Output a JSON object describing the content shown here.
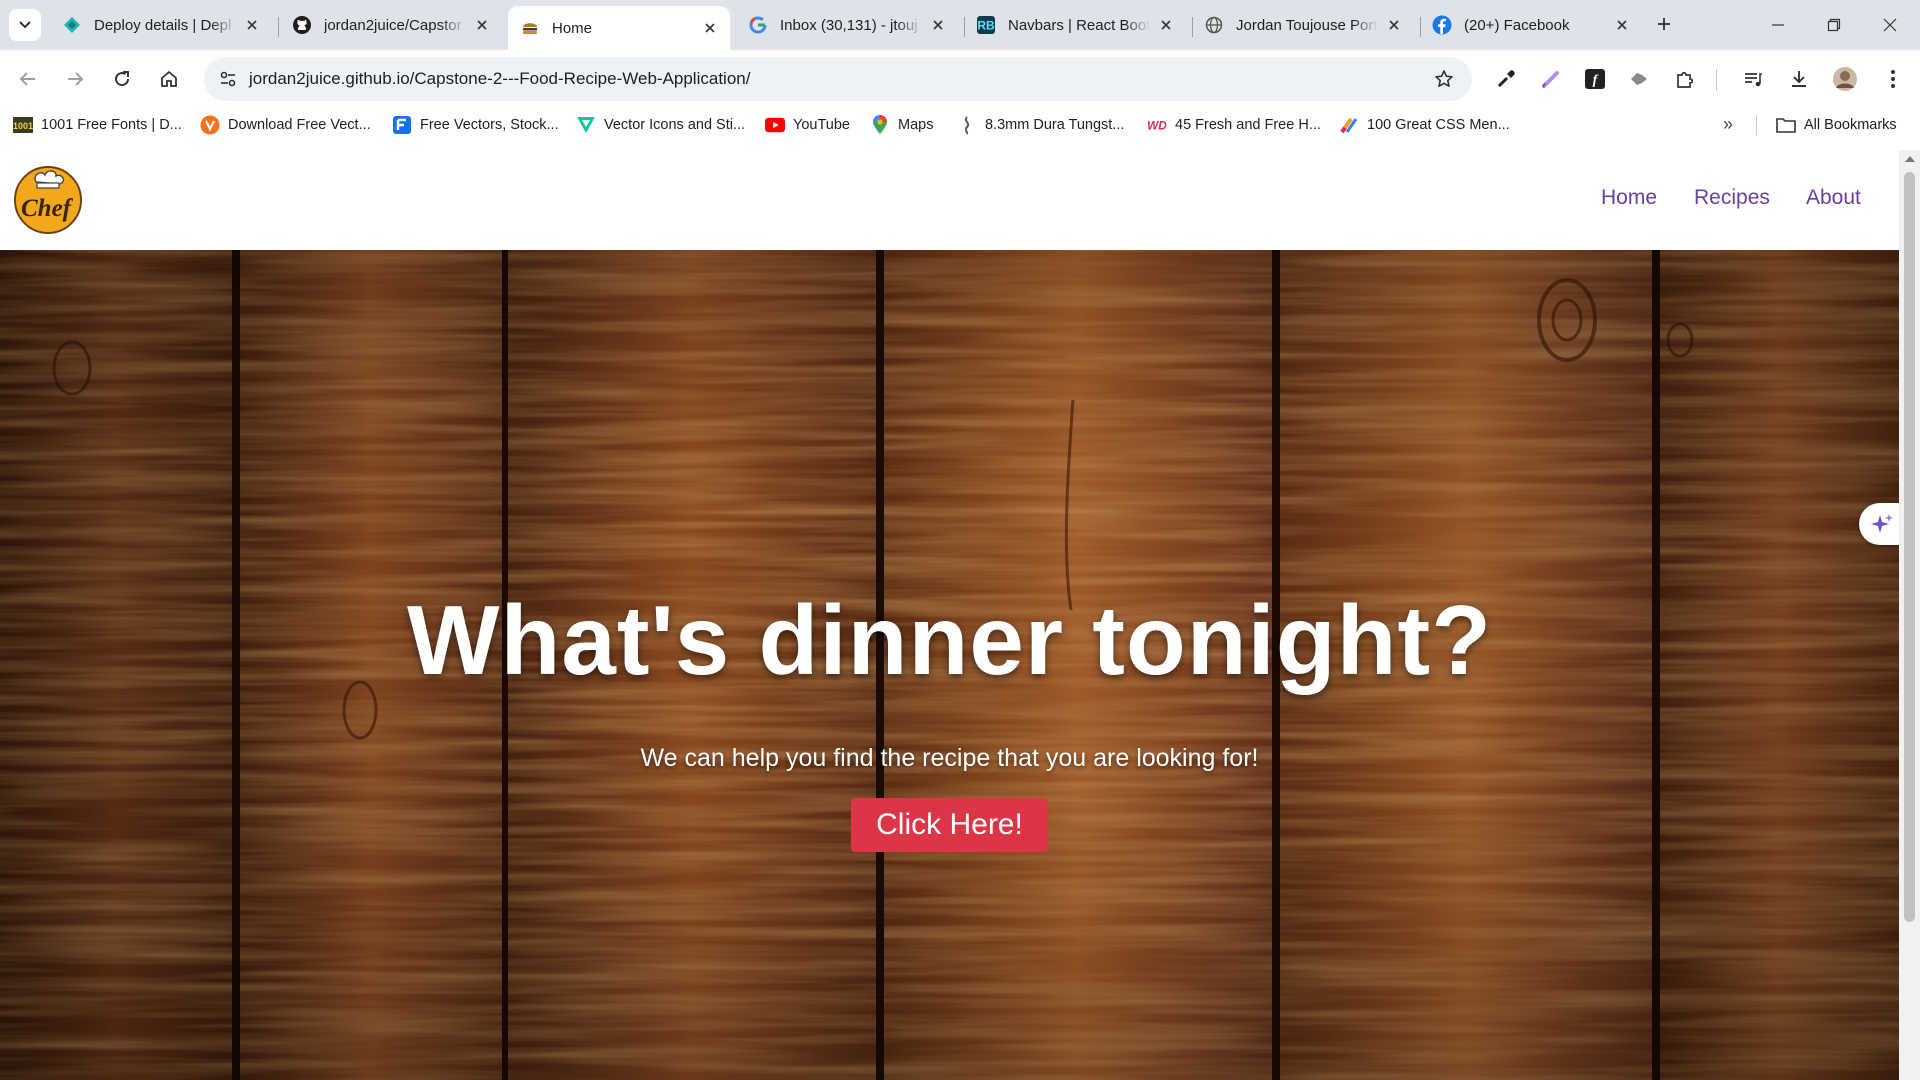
{
  "browser": {
    "tabs": [
      {
        "title": "Deploy details | Depl",
        "icon": "netlify-icon",
        "active": false
      },
      {
        "title": "jordan2juice/Capstor",
        "icon": "github-icon",
        "active": false
      },
      {
        "title": "Home",
        "icon": "burger-icon",
        "active": true
      },
      {
        "title": "Inbox (30,131) - jtouj",
        "icon": "google-icon",
        "active": false
      },
      {
        "title": "Navbars | React Boot",
        "icon": "react-bootstrap-icon",
        "active": false
      },
      {
        "title": "Jordan Toujouse Port",
        "icon": "globe-icon",
        "active": false
      },
      {
        "title": "(20+) Facebook",
        "icon": "facebook-icon",
        "active": false
      }
    ],
    "url": "jordan2juice.github.io/Capstone-2---Food-Recipe-Web-Application/",
    "bookmarks": [
      {
        "label": "1001 Free Fonts | D...",
        "icon": "fonts-icon"
      },
      {
        "label": "Download Free Vect...",
        "icon": "vecteezy-icon"
      },
      {
        "label": "Free Vectors, Stock...",
        "icon": "freepik-icon"
      },
      {
        "label": "Vector Icons and Sti...",
        "icon": "flaticon-icon"
      },
      {
        "label": "YouTube",
        "icon": "youtube-icon"
      },
      {
        "label": "Maps",
        "icon": "maps-icon"
      },
      {
        "label": "8.3mm Dura Tungst...",
        "icon": "ring-icon"
      },
      {
        "label": "45 Fresh and Free H...",
        "icon": "wd-icon"
      },
      {
        "label": "100 Great CSS Men...",
        "icon": "css-icon"
      }
    ],
    "all_bookmarks": "All Bookmarks"
  },
  "site": {
    "nav": {
      "home": "Home",
      "recipes": "Recipes",
      "about": "About"
    },
    "hero": {
      "title": "What's dinner tonight?",
      "subtitle": "We can help you find the recipe that you are looking for!",
      "button": "Click Here!"
    }
  },
  "colors": {
    "nav_link": "#6a3fa0",
    "cta": "#dc3545",
    "wood": "#5a2e14",
    "chrome_tabbar": "#dee3ea"
  }
}
